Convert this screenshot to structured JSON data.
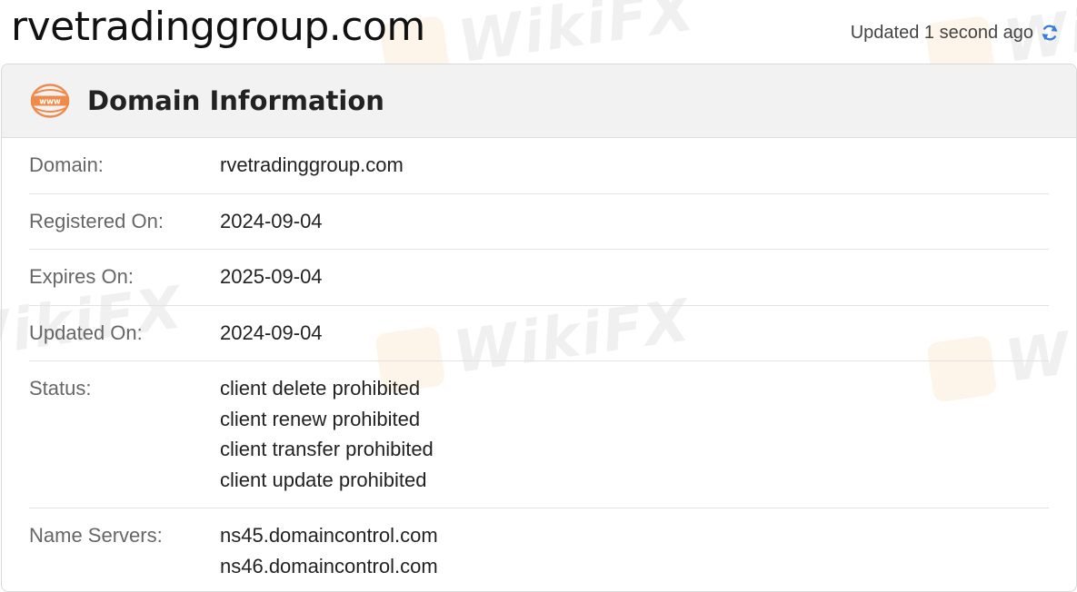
{
  "page": {
    "title": "rvetradinggroup.com",
    "updated_text": "Updated 1 second ago"
  },
  "watermark": {
    "text": "WikiFX"
  },
  "domain_info": {
    "heading": "Domain Information",
    "icon_label": "www",
    "rows": [
      {
        "label": "Domain:",
        "values": [
          "rvetradinggroup.com"
        ]
      },
      {
        "label": "Registered On:",
        "values": [
          "2024-09-04"
        ]
      },
      {
        "label": "Expires On:",
        "values": [
          "2025-09-04"
        ]
      },
      {
        "label": "Updated On:",
        "values": [
          "2024-09-04"
        ]
      },
      {
        "label": "Status:",
        "values": [
          "client delete prohibited",
          "client renew prohibited",
          "client transfer prohibited",
          "client update prohibited"
        ]
      },
      {
        "label": "Name Servers:",
        "values": [
          "ns45.domaincontrol.com",
          "ns46.domaincontrol.com"
        ]
      }
    ]
  },
  "colors": {
    "accent_orange": "#f08a4b",
    "refresh_blue": "#3a7fd5",
    "header_bg": "#f2f2f2"
  },
  "icons": {
    "refresh": "refresh-icon",
    "www": "www-icon"
  }
}
